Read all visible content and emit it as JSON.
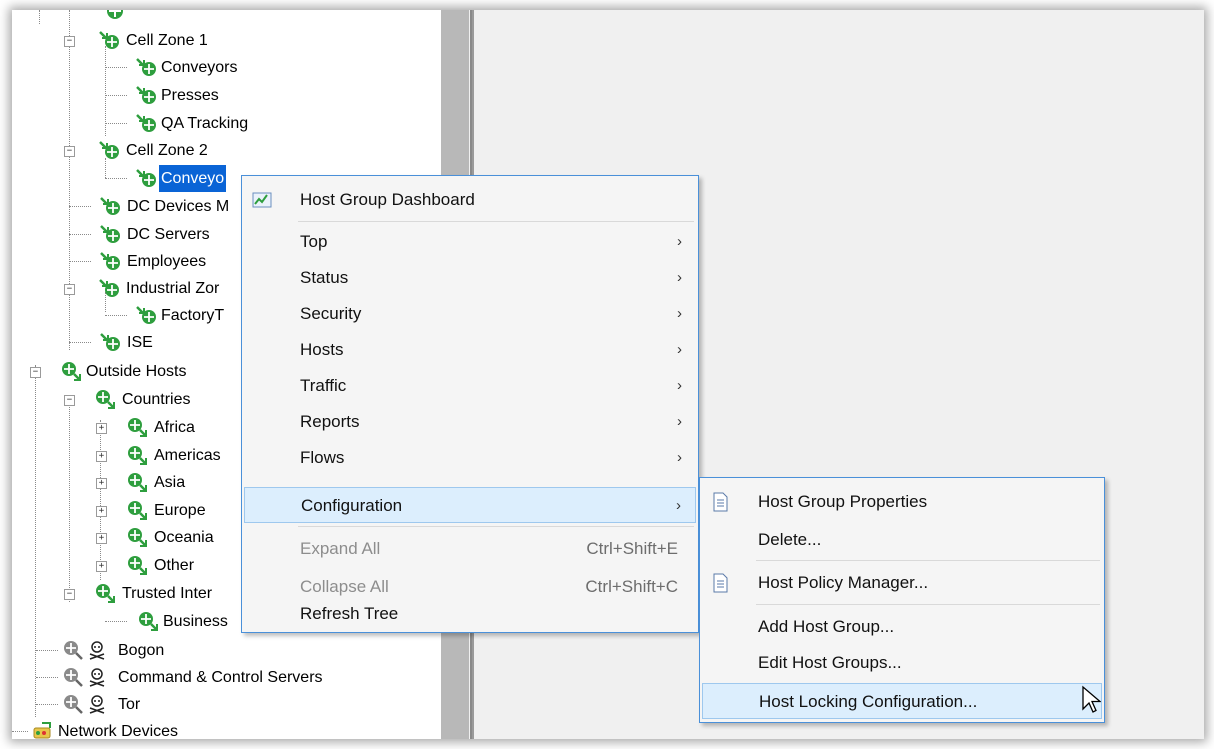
{
  "tree": {
    "nodes": [
      {
        "label": "",
        "type": "inside"
      },
      {
        "label": "Cell Zone 1",
        "type": "inside"
      },
      {
        "label": "Conveyors",
        "type": "inside"
      },
      {
        "label": "Presses",
        "type": "inside"
      },
      {
        "label": "QA Tracking",
        "type": "inside"
      },
      {
        "label": "Cell Zone 2",
        "type": "inside"
      },
      {
        "label": "Conveyo",
        "type": "inside",
        "selected": true
      },
      {
        "label": "DC Devices M",
        "type": "inside"
      },
      {
        "label": "DC Servers",
        "type": "inside"
      },
      {
        "label": "Employees",
        "type": "inside"
      },
      {
        "label": "Industrial Zor",
        "type": "inside"
      },
      {
        "label": "FactoryT",
        "type": "inside"
      },
      {
        "label": "ISE",
        "type": "inside"
      },
      {
        "label": "Outside Hosts",
        "type": "outside"
      },
      {
        "label": "Countries",
        "type": "outside"
      },
      {
        "label": "Africa",
        "type": "outside"
      },
      {
        "label": "Americas",
        "type": "outside"
      },
      {
        "label": "Asia",
        "type": "outside"
      },
      {
        "label": "Europe",
        "type": "outside"
      },
      {
        "label": "Oceania",
        "type": "outside"
      },
      {
        "label": "Other",
        "type": "outside"
      },
      {
        "label": "Trusted Inter",
        "type": "outside"
      },
      {
        "label": "Business",
        "type": "outside"
      },
      {
        "label": "Bogon",
        "type": "threat"
      },
      {
        "label": "Command & Control Servers",
        "type": "threat"
      },
      {
        "label": "Tor",
        "type": "threat"
      },
      {
        "label": "Network Devices",
        "type": "network"
      }
    ]
  },
  "context_menu": {
    "items": [
      {
        "label": "Host Group Dashboard",
        "icon": "dashboard-chart-icon"
      },
      {
        "label": "Top",
        "submenu": true
      },
      {
        "label": "Status",
        "submenu": true
      },
      {
        "label": "Security",
        "submenu": true
      },
      {
        "label": "Hosts",
        "submenu": true
      },
      {
        "label": "Traffic",
        "submenu": true
      },
      {
        "label": "Reports",
        "submenu": true
      },
      {
        "label": "Flows",
        "submenu": true
      },
      {
        "label": "Configuration",
        "submenu": true,
        "highlighted": true
      },
      {
        "label": "Expand All",
        "shortcut": "Ctrl+Shift+E",
        "disabled": true
      },
      {
        "label": "Collapse All",
        "shortcut": "Ctrl+Shift+C",
        "disabled": true
      },
      {
        "label": "Refresh Tree"
      }
    ]
  },
  "submenu": {
    "items": [
      {
        "label": "Host Group Properties",
        "icon": "document-icon"
      },
      {
        "label": "Delete..."
      },
      {
        "label": "Host Policy Manager...",
        "icon": "document-icon"
      },
      {
        "label": "Add Host Group..."
      },
      {
        "label": "Edit Host Groups..."
      },
      {
        "label": "Host Locking Configuration...",
        "highlighted": true
      }
    ]
  },
  "colors": {
    "selection": "#0a64d6",
    "menu_highlight": "#dceefd",
    "menu_border": "#4a90d9",
    "icon_green": "#2e9e3e"
  }
}
